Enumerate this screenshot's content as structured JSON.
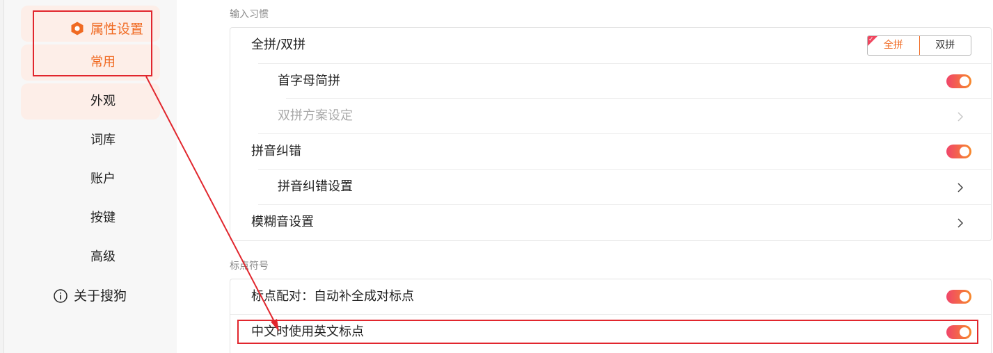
{
  "sidebar": {
    "category": {
      "label": "属性设置",
      "icon": "hexagon-settings-icon"
    },
    "items": [
      {
        "label": "常用"
      },
      {
        "label": "外观"
      },
      {
        "label": "词库"
      },
      {
        "label": "账户"
      },
      {
        "label": "按键"
      },
      {
        "label": "高级"
      }
    ],
    "about": {
      "label": "关于搜狗",
      "icon": "info-circle-icon"
    }
  },
  "sections": [
    {
      "title": "输入习惯",
      "rows": [
        {
          "label": "全拼/双拼",
          "control": "segmented",
          "options": [
            "全拼",
            "双拼"
          ],
          "selected": "全拼"
        },
        {
          "label": "首字母简拼",
          "control": "toggle",
          "on": true
        },
        {
          "label": "双拼方案设定",
          "control": "chevron",
          "disabled": true
        },
        {
          "label": "拼音纠错",
          "control": "toggle",
          "on": true
        },
        {
          "label": "拼音纠错设置",
          "control": "chevron"
        },
        {
          "label": "模糊音设置",
          "control": "chevron"
        }
      ]
    },
    {
      "title": "标点符号",
      "rows": [
        {
          "label": "标点配对：自动补全成对标点",
          "control": "toggle",
          "on": true
        },
        {
          "label": "中文时使用英文标点",
          "control": "toggle",
          "on": true
        }
      ]
    }
  ],
  "colors": {
    "accent": "#f06a22",
    "toggle_start": "#f0456a",
    "toggle_end": "#f7892a",
    "annotation": "#e1262d"
  }
}
